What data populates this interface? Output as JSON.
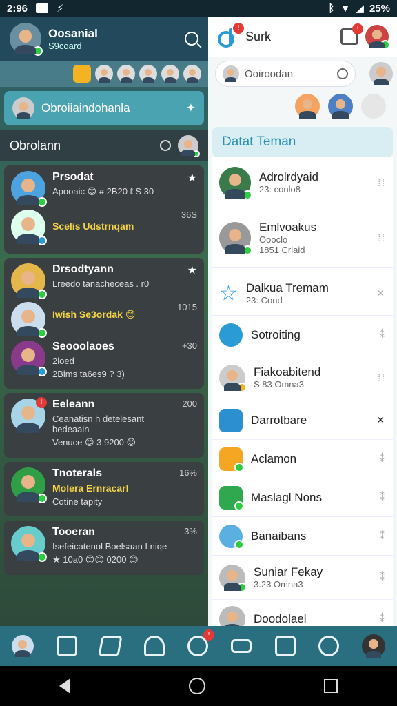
{
  "status": {
    "time": "2:96",
    "battery": "25%"
  },
  "left": {
    "title": "Oosanial",
    "subtitle": "S9coard",
    "banner": "Obroiiaindohanla",
    "section": "Obrolann",
    "chats": [
      {
        "name": "Prsodat",
        "msg": "Apooaic 😊 # 2B20 ℓ S 30",
        "sub": "Scelis Udstrnqam",
        "time": "36S"
      },
      {
        "name": "Drsodtyann",
        "msg": "Lreedo tanacheceas . r0",
        "sub": "Iwish Se3ordak 😊",
        "time": "1015"
      },
      {
        "name": "Seooolaoes",
        "msg": "2loed",
        "sub": "2Bims ta6es9 ? 3)",
        "time": "+30"
      },
      {
        "name": "Eeleann",
        "msg": "Ceanatisn h detelesant bedeaain",
        "sub": "Venuce 😊 3 9200 😊",
        "time": "200"
      },
      {
        "name": "Tnoterals",
        "msg": "Molera Ernracarl",
        "sub": "Cotine tapity",
        "time": "16%"
      },
      {
        "name": "Tooeran",
        "msg": "Isefeicatenol Boelsaan I niqe",
        "sub": "★ 10a0 😊😊 0200 😊",
        "time": "3%"
      }
    ]
  },
  "right": {
    "title": "Surk",
    "search_placeholder": "Ooiroodan",
    "section": "Datat Teman",
    "items": [
      {
        "name": "Adrolrdyaid",
        "sub": "23: conlo8"
      },
      {
        "name": "Emlvoakus",
        "sub": "Oooclo\n1851 Crlaid"
      },
      {
        "name": "Dalkua Tremam",
        "sub": "23: Cond"
      },
      {
        "name": "Sotroiting",
        "sub": ""
      },
      {
        "name": "Fiakoabitend",
        "sub": "S 83 Omna3"
      },
      {
        "name": "Darrotbare",
        "sub": ""
      },
      {
        "name": "Aclamon",
        "sub": ""
      },
      {
        "name": "Maslagl Nons",
        "sub": ""
      },
      {
        "name": "Banaibans",
        "sub": ""
      },
      {
        "name": "Suniar Fekay",
        "sub": "3.23 Omna3"
      },
      {
        "name": "Doodolael",
        "sub": ""
      }
    ]
  },
  "colors": {
    "accent": "#2b9bd6",
    "online": "#2ecc40"
  }
}
